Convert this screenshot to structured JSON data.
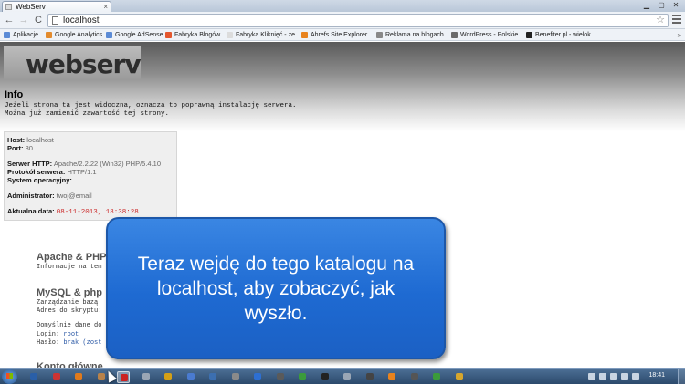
{
  "browser": {
    "tab_title": "WebServ",
    "tab_close": "×",
    "url": "localhost",
    "back": "←",
    "forward": "→",
    "reload": "C",
    "star": "☆",
    "bookmarks": [
      {
        "label": "Aplikacje",
        "color": "#5b8bd6"
      },
      {
        "label": "Google Analytics",
        "color": "#e38b2d"
      },
      {
        "label": "Google AdSense",
        "color": "#5b8bd6"
      },
      {
        "label": "Fabryka Blogów",
        "color": "#e4572e"
      },
      {
        "label": "Fabryka Kliknięć - ze...",
        "color": "#dcdcdc"
      },
      {
        "label": "Ahrefs Site Explorer ...",
        "color": "#e8831e"
      },
      {
        "label": "Reklama na blogach...",
        "color": "#888888"
      },
      {
        "label": "WordPress - Polskie ...",
        "color": "#6a6a6a"
      },
      {
        "label": "Benefiter.pl - wielok...",
        "color": "#222222"
      }
    ],
    "bookmarks_more": "»"
  },
  "page": {
    "logo": "webserv",
    "info_title": "Info",
    "info_line1": "Jeżeli strona ta jest widoczna, oznacza to poprawną instalację serwera.",
    "info_line2": "Można już zamienić zawartość tej strony.",
    "system": {
      "host_label": "Host:",
      "host_value": "localhost",
      "port_label": "Port:",
      "port_value": "80",
      "http_label": "Serwer HTTP:",
      "http_value": "Apache/2.2.22 (Win32) PHP/5.4.10",
      "protocol_label": "Protokół serwera:",
      "protocol_value": "HTTP/1.1",
      "os_label": "System operacyjny:",
      "admin_label": "Administrator:",
      "admin_value": "twoj@email",
      "date_label": "Aktualna data:",
      "date_value": "08-11-2013, 18:38:28"
    },
    "apache_title": "Apache & PHP",
    "apache_desc": "Informacje na tem",
    "mysql_title": "MySQL & php",
    "mysql_line1": "Zarządzanie bazą",
    "mysql_line2": "Adres do skryptu:",
    "mysql_line3": "Domyślnie dane do",
    "login_label": "Login:",
    "login_value": "root",
    "password_label": "Hasło:",
    "password_value": "brak (zost",
    "konto_title": "Konto główne"
  },
  "callout": {
    "text": "Teraz wejdę do tego katalogu na localhost, aby zobaczyć, jak wyszło."
  },
  "taskbar": {
    "clock": "18:41",
    "icons": [
      "#2a5fa8",
      "#cc3333",
      "#e07a1c",
      "#b8824a",
      "#cc2222",
      "#9aa6b5",
      "#d4a017",
      "#4a7bd0",
      "#3c6fb0",
      "#8a8a8a",
      "#2d6fd2",
      "#5a5a5a",
      "#3b9b3b",
      "#222222",
      "#9aa6b5",
      "#444444",
      "#e8831e",
      "#555555",
      "#3b9b3b",
      "#d6a62d"
    ]
  }
}
